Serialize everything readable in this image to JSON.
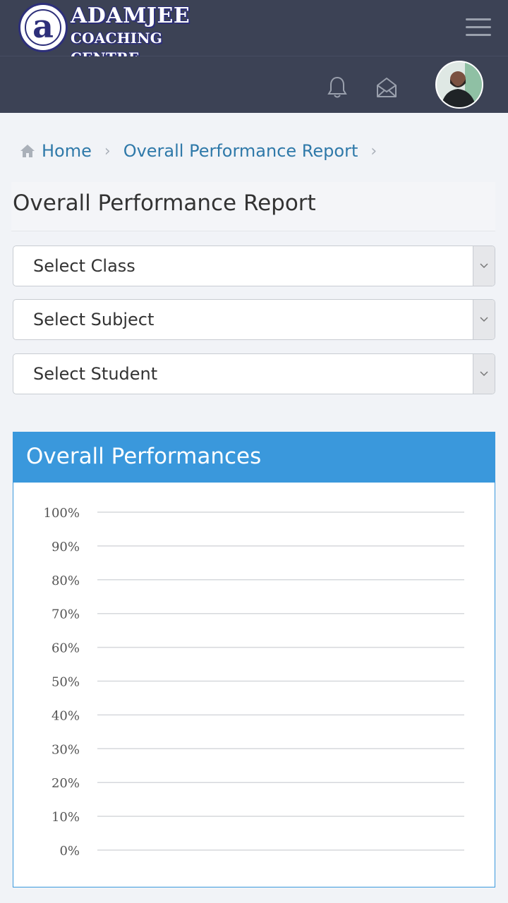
{
  "header": {
    "logo_line1": "ADAMJEE",
    "logo_line2": "COACHING CENTRE",
    "logo_letter": "a"
  },
  "breadcrumb": [
    {
      "label": "Home",
      "icon": "home-icon"
    },
    {
      "label": "Overall Performance Report"
    }
  ],
  "page": {
    "title": "Overall Performance Report"
  },
  "filters": {
    "class_select": "Select Class",
    "subject_select": "Select Subject",
    "student_select": "Select Student"
  },
  "chart_card": {
    "title": "Overall Performances"
  },
  "colors": {
    "topbar": "#3c4255",
    "accent": "#3a98dc",
    "link": "#2f79a9"
  },
  "chart_data": {
    "type": "bar",
    "categories": [],
    "series": [],
    "ylim": [
      0,
      100
    ],
    "yticks": [
      "0%",
      "10%",
      "20%",
      "30%",
      "40%",
      "50%",
      "60%",
      "70%",
      "80%",
      "90%",
      "100%"
    ],
    "grid": true
  }
}
